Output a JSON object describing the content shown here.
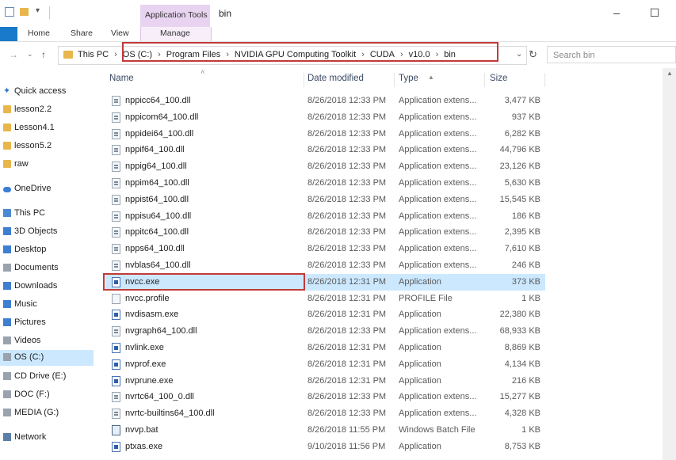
{
  "titlebar": {
    "context_tab": "Application Tools",
    "window_title": "bin",
    "qat_down": "▾"
  },
  "ribbon": {
    "tabs": [
      "Home",
      "Share",
      "View"
    ],
    "manage": "Manage"
  },
  "address": {
    "crumbs": [
      "This PC",
      "OS (C:)",
      "Program Files",
      "NVIDIA GPU Computing Toolkit",
      "CUDA",
      "v10.0",
      "bin"
    ],
    "search_placeholder": "Search bin"
  },
  "sidebar": {
    "items": [
      {
        "label": "Quick access",
        "icon": "star-icon"
      },
      {
        "label": "lesson2.2",
        "icon": "folder-icon"
      },
      {
        "label": "Lesson4.1",
        "icon": "folder-icon"
      },
      {
        "label": "lesson5.2",
        "icon": "folder-icon"
      },
      {
        "label": "raw",
        "icon": "folder-icon"
      },
      {
        "label": "OneDrive",
        "icon": "cloud-icon"
      },
      {
        "label": "This PC",
        "icon": "computer-icon"
      },
      {
        "label": "3D Objects",
        "icon": "cube-icon"
      },
      {
        "label": "Desktop",
        "icon": "desktop-icon"
      },
      {
        "label": "Documents",
        "icon": "documents-icon"
      },
      {
        "label": "Downloads",
        "icon": "download-icon"
      },
      {
        "label": "Music",
        "icon": "music-icon"
      },
      {
        "label": "Pictures",
        "icon": "pictures-icon"
      },
      {
        "label": "Videos",
        "icon": "videos-icon"
      },
      {
        "label": "OS (C:)",
        "icon": "drive-icon"
      },
      {
        "label": "CD Drive (E:)",
        "icon": "cd-drive-icon"
      },
      {
        "label": "DOC (F:)",
        "icon": "drive-icon"
      },
      {
        "label": "MEDIA (G:)",
        "icon": "drive-icon"
      },
      {
        "label": "Network",
        "icon": "network-icon"
      }
    ]
  },
  "columns": {
    "name": "Name",
    "date": "Date modified",
    "type": "Type",
    "size": "Size"
  },
  "files": [
    {
      "name": "nppicc64_100.dll",
      "date": "8/26/2018 12:33 PM",
      "type": "Application extens...",
      "size": "3,477 KB",
      "icon": "dll"
    },
    {
      "name": "nppicom64_100.dll",
      "date": "8/26/2018 12:33 PM",
      "type": "Application extens...",
      "size": "937 KB",
      "icon": "dll"
    },
    {
      "name": "nppidei64_100.dll",
      "date": "8/26/2018 12:33 PM",
      "type": "Application extens...",
      "size": "6,282 KB",
      "icon": "dll"
    },
    {
      "name": "nppif64_100.dll",
      "date": "8/26/2018 12:33 PM",
      "type": "Application extens...",
      "size": "44,796 KB",
      "icon": "dll"
    },
    {
      "name": "nppig64_100.dll",
      "date": "8/26/2018 12:33 PM",
      "type": "Application extens...",
      "size": "23,126 KB",
      "icon": "dll"
    },
    {
      "name": "nppim64_100.dll",
      "date": "8/26/2018 12:33 PM",
      "type": "Application extens...",
      "size": "5,630 KB",
      "icon": "dll"
    },
    {
      "name": "nppist64_100.dll",
      "date": "8/26/2018 12:33 PM",
      "type": "Application extens...",
      "size": "15,545 KB",
      "icon": "dll"
    },
    {
      "name": "nppisu64_100.dll",
      "date": "8/26/2018 12:33 PM",
      "type": "Application extens...",
      "size": "186 KB",
      "icon": "dll"
    },
    {
      "name": "nppitc64_100.dll",
      "date": "8/26/2018 12:33 PM",
      "type": "Application extens...",
      "size": "2,395 KB",
      "icon": "dll"
    },
    {
      "name": "npps64_100.dll",
      "date": "8/26/2018 12:33 PM",
      "type": "Application extens...",
      "size": "7,610 KB",
      "icon": "dll"
    },
    {
      "name": "nvblas64_100.dll",
      "date": "8/26/2018 12:33 PM",
      "type": "Application extens...",
      "size": "246 KB",
      "icon": "dll"
    },
    {
      "name": "nvcc.exe",
      "date": "8/26/2018 12:31 PM",
      "type": "Application",
      "size": "373 KB",
      "icon": "exe"
    },
    {
      "name": "nvcc.profile",
      "date": "8/26/2018 12:31 PM",
      "type": "PROFILE File",
      "size": "1 KB",
      "icon": "file"
    },
    {
      "name": "nvdisasm.exe",
      "date": "8/26/2018 12:31 PM",
      "type": "Application",
      "size": "22,380 KB",
      "icon": "exe"
    },
    {
      "name": "nvgraph64_100.dll",
      "date": "8/26/2018 12:33 PM",
      "type": "Application extens...",
      "size": "68,933 KB",
      "icon": "dll"
    },
    {
      "name": "nvlink.exe",
      "date": "8/26/2018 12:31 PM",
      "type": "Application",
      "size": "8,869 KB",
      "icon": "exe"
    },
    {
      "name": "nvprof.exe",
      "date": "8/26/2018 12:31 PM",
      "type": "Application",
      "size": "4,134 KB",
      "icon": "exe"
    },
    {
      "name": "nvprune.exe",
      "date": "8/26/2018 12:31 PM",
      "type": "Application",
      "size": "216 KB",
      "icon": "exe"
    },
    {
      "name": "nvrtc64_100_0.dll",
      "date": "8/26/2018 12:33 PM",
      "type": "Application extens...",
      "size": "15,277 KB",
      "icon": "dll"
    },
    {
      "name": "nvrtc-builtins64_100.dll",
      "date": "8/26/2018 12:33 PM",
      "type": "Application extens...",
      "size": "4,328 KB",
      "icon": "dll"
    },
    {
      "name": "nvvp.bat",
      "date": "8/26/2018 11:55 PM",
      "type": "Windows Batch File",
      "size": "1 KB",
      "icon": "bat"
    },
    {
      "name": "ptxas.exe",
      "date": "9/10/2018 11:56 PM",
      "type": "Application",
      "size": "8,753 KB",
      "icon": "exe"
    }
  ],
  "selected_file": "nvcc.exe",
  "colors": {
    "accent": "#1979ca",
    "selection": "#cce8ff",
    "highlight_box": "#c23a3a",
    "context_tab": "#e8d3f0"
  }
}
